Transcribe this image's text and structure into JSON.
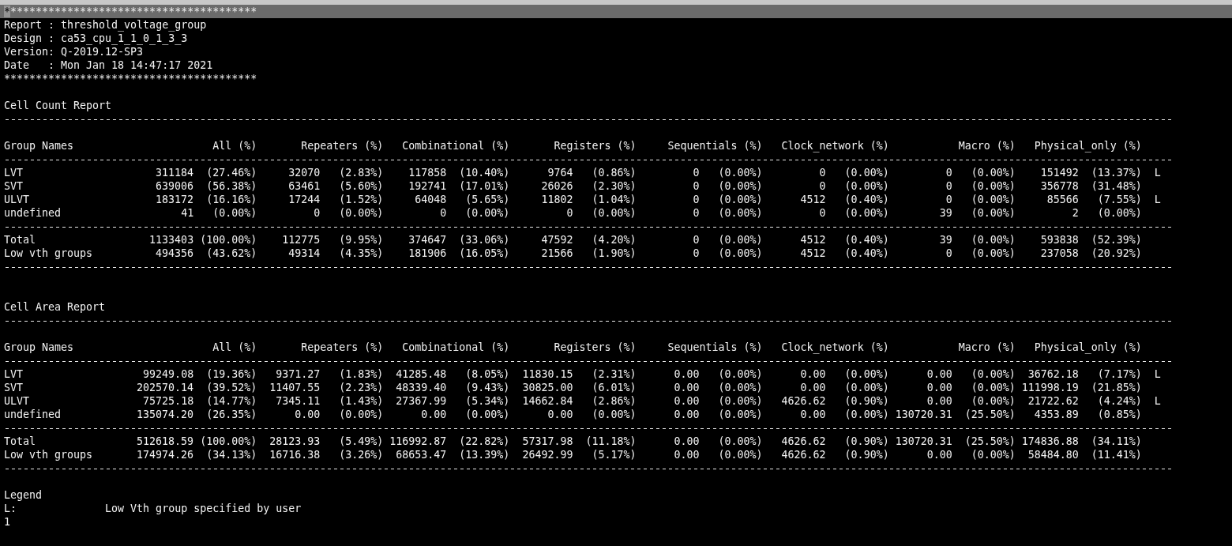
{
  "terminal": {
    "cursor": true,
    "highlighted_first_line": true
  },
  "header": {
    "top_rule": "****************************************",
    "lines": [
      "Report : threshold_voltage_group",
      "Design : ca53_cpu_1_1_0_1_3_3",
      "Version: Q-2019.12-SP3",
      "Date   : Mon Jan 18 14:47:17 2021"
    ],
    "bottom_rule": "****************************************"
  },
  "reports": [
    {
      "title": "Cell Count Report",
      "name_column": "Group Names",
      "columns": [
        "All (%)",
        "Repeaters (%)",
        "Combinational (%)",
        "Registers (%)",
        "Sequentials (%)",
        "Clock_network (%)",
        "Macro (%)",
        "Physical_only (%)"
      ],
      "rows": [
        {
          "name": "LVT",
          "cells": [
            {
              "value": "311184",
              "percent": "(27.46%)"
            },
            {
              "value": "32070",
              "percent": "(2.83%)"
            },
            {
              "value": "117858",
              "percent": "(10.40%)"
            },
            {
              "value": "9764",
              "percent": "(0.86%)"
            },
            {
              "value": "0",
              "percent": "(0.00%)"
            },
            {
              "value": "0",
              "percent": "(0.00%)"
            },
            {
              "value": "0",
              "percent": "(0.00%)"
            },
            {
              "value": "151492",
              "percent": "(13.37%)"
            }
          ],
          "marker": "L"
        },
        {
          "name": "SVT",
          "cells": [
            {
              "value": "639006",
              "percent": "(56.38%)"
            },
            {
              "value": "63461",
              "percent": "(5.60%)"
            },
            {
              "value": "192741",
              "percent": "(17.01%)"
            },
            {
              "value": "26026",
              "percent": "(2.30%)"
            },
            {
              "value": "0",
              "percent": "(0.00%)"
            },
            {
              "value": "0",
              "percent": "(0.00%)"
            },
            {
              "value": "0",
              "percent": "(0.00%)"
            },
            {
              "value": "356778",
              "percent": "(31.48%)"
            }
          ]
        },
        {
          "name": "ULVT",
          "cells": [
            {
              "value": "183172",
              "percent": "(16.16%)"
            },
            {
              "value": "17244",
              "percent": "(1.52%)"
            },
            {
              "value": "64048",
              "percent": "(5.65%)"
            },
            {
              "value": "11802",
              "percent": "(1.04%)"
            },
            {
              "value": "0",
              "percent": "(0.00%)"
            },
            {
              "value": "4512",
              "percent": "(0.40%)"
            },
            {
              "value": "0",
              "percent": "(0.00%)"
            },
            {
              "value": "85566",
              "percent": "(7.55%)"
            }
          ],
          "marker": "L"
        },
        {
          "name": "undefined",
          "cells": [
            {
              "value": "41",
              "percent": "(0.00%)"
            },
            {
              "value": "0",
              "percent": "(0.00%)"
            },
            {
              "value": "0",
              "percent": "(0.00%)"
            },
            {
              "value": "0",
              "percent": "(0.00%)"
            },
            {
              "value": "0",
              "percent": "(0.00%)"
            },
            {
              "value": "0",
              "percent": "(0.00%)"
            },
            {
              "value": "39",
              "percent": "(0.00%)"
            },
            {
              "value": "2",
              "percent": "(0.00%)"
            }
          ]
        }
      ],
      "totals": [
        {
          "name": "Total",
          "cells": [
            {
              "value": "1133403",
              "percent": "(100.00%)"
            },
            {
              "value": "112775",
              "percent": "(9.95%)"
            },
            {
              "value": "374647",
              "percent": "(33.06%)"
            },
            {
              "value": "47592",
              "percent": "(4.20%)"
            },
            {
              "value": "0",
              "percent": "(0.00%)"
            },
            {
              "value": "4512",
              "percent": "(0.40%)"
            },
            {
              "value": "39",
              "percent": "(0.00%)"
            },
            {
              "value": "593838",
              "percent": "(52.39%)"
            }
          ]
        },
        {
          "name": "Low vth groups",
          "cells": [
            {
              "value": "494356",
              "percent": "(43.62%)"
            },
            {
              "value": "49314",
              "percent": "(4.35%)"
            },
            {
              "value": "181906",
              "percent": "(16.05%)"
            },
            {
              "value": "21566",
              "percent": "(1.90%)"
            },
            {
              "value": "0",
              "percent": "(0.00%)"
            },
            {
              "value": "4512",
              "percent": "(0.40%)"
            },
            {
              "value": "0",
              "percent": "(0.00%)"
            },
            {
              "value": "237058",
              "percent": "(20.92%)"
            }
          ]
        }
      ]
    },
    {
      "title": "Cell Area Report",
      "name_column": "Group Names",
      "columns": [
        "All (%)",
        "Repeaters (%)",
        "Combinational (%)",
        "Registers (%)",
        "Sequentials (%)",
        "Clock_network (%)",
        "Macro (%)",
        "Physical_only (%)"
      ],
      "rows": [
        {
          "name": "LVT",
          "cells": [
            {
              "value": "99249.08",
              "percent": "(19.36%)"
            },
            {
              "value": "9371.27",
              "percent": "(1.83%)"
            },
            {
              "value": "41285.48",
              "percent": "(8.05%)"
            },
            {
              "value": "11830.15",
              "percent": "(2.31%)"
            },
            {
              "value": "0.00",
              "percent": "(0.00%)"
            },
            {
              "value": "0.00",
              "percent": "(0.00%)"
            },
            {
              "value": "0.00",
              "percent": "(0.00%)"
            },
            {
              "value": "36762.18",
              "percent": "(7.17%)"
            }
          ],
          "marker": "L"
        },
        {
          "name": "SVT",
          "cells": [
            {
              "value": "202570.14",
              "percent": "(39.52%)"
            },
            {
              "value": "11407.55",
              "percent": "(2.23%)"
            },
            {
              "value": "48339.40",
              "percent": "(9.43%)"
            },
            {
              "value": "30825.00",
              "percent": "(6.01%)"
            },
            {
              "value": "0.00",
              "percent": "(0.00%)"
            },
            {
              "value": "0.00",
              "percent": "(0.00%)"
            },
            {
              "value": "0.00",
              "percent": "(0.00%)"
            },
            {
              "value": "111998.19",
              "percent": "(21.85%)"
            }
          ]
        },
        {
          "name": "ULVT",
          "cells": [
            {
              "value": "75725.18",
              "percent": "(14.77%)"
            },
            {
              "value": "7345.11",
              "percent": "(1.43%)"
            },
            {
              "value": "27367.99",
              "percent": "(5.34%)"
            },
            {
              "value": "14662.84",
              "percent": "(2.86%)"
            },
            {
              "value": "0.00",
              "percent": "(0.00%)"
            },
            {
              "value": "4626.62",
              "percent": "(0.90%)"
            },
            {
              "value": "0.00",
              "percent": "(0.00%)"
            },
            {
              "value": "21722.62",
              "percent": "(4.24%)"
            }
          ],
          "marker": "L"
        },
        {
          "name": "undefined",
          "cells": [
            {
              "value": "135074.20",
              "percent": "(26.35%)"
            },
            {
              "value": "0.00",
              "percent": "(0.00%)"
            },
            {
              "value": "0.00",
              "percent": "(0.00%)"
            },
            {
              "value": "0.00",
              "percent": "(0.00%)"
            },
            {
              "value": "0.00",
              "percent": "(0.00%)"
            },
            {
              "value": "0.00",
              "percent": "(0.00%)"
            },
            {
              "value": "130720.31",
              "percent": "(25.50%)"
            },
            {
              "value": "4353.89",
              "percent": "(0.85%)"
            }
          ]
        }
      ],
      "totals": [
        {
          "name": "Total",
          "cells": [
            {
              "value": "512618.59",
              "percent": "(100.00%)"
            },
            {
              "value": "28123.93",
              "percent": "(5.49%)"
            },
            {
              "value": "116992.87",
              "percent": "(22.82%)"
            },
            {
              "value": "57317.98",
              "percent": "(11.18%)"
            },
            {
              "value": "0.00",
              "percent": "(0.00%)"
            },
            {
              "value": "4626.62",
              "percent": "(0.90%)"
            },
            {
              "value": "130720.31",
              "percent": "(25.50%)"
            },
            {
              "value": "174836.88",
              "percent": "(34.11%)"
            }
          ]
        },
        {
          "name": "Low vth groups",
          "cells": [
            {
              "value": "174974.26",
              "percent": "(34.13%)"
            },
            {
              "value": "16716.38",
              "percent": "(3.26%)"
            },
            {
              "value": "68653.47",
              "percent": "(13.39%)"
            },
            {
              "value": "26492.99",
              "percent": "(5.17%)"
            },
            {
              "value": "0.00",
              "percent": "(0.00%)"
            },
            {
              "value": "4626.62",
              "percent": "(0.90%)"
            },
            {
              "value": "0.00",
              "percent": "(0.00%)"
            },
            {
              "value": "58484.80",
              "percent": "(11.41%)"
            }
          ]
        }
      ]
    }
  ],
  "legend": {
    "title": "Legend",
    "entries": [
      {
        "key": "L:",
        "description": "Low Vth group specified by user"
      }
    ]
  },
  "trailing_lines": [
    "1"
  ]
}
